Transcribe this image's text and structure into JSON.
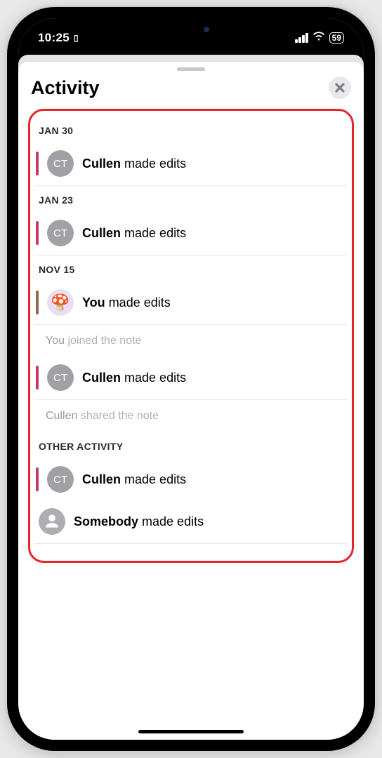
{
  "status": {
    "time": "10:25",
    "battery": "59"
  },
  "sheet": {
    "title": "Activity"
  },
  "sections": [
    {
      "key": "s0",
      "header": "JAN 30",
      "items": [
        {
          "kind": "edit",
          "bar": "pink",
          "avatar": "initials",
          "initials": "CT",
          "who": "Cullen",
          "action": "made edits"
        }
      ]
    },
    {
      "key": "s1",
      "header": "JAN 23",
      "items": [
        {
          "kind": "edit",
          "bar": "pink",
          "avatar": "initials",
          "initials": "CT",
          "who": "Cullen",
          "action": "made edits"
        }
      ]
    },
    {
      "key": "s2",
      "header": "NOV 15",
      "items": [
        {
          "kind": "edit",
          "bar": "brown",
          "avatar": "emoji",
          "emoji": "🍄",
          "who": "You",
          "action": "made edits"
        },
        {
          "kind": "meta",
          "who": "You",
          "action": "joined the note"
        },
        {
          "kind": "edit",
          "bar": "pink",
          "avatar": "initials",
          "initials": "CT",
          "who": "Cullen",
          "action": "made edits"
        },
        {
          "kind": "meta",
          "who": "Cullen",
          "action": "shared the note"
        }
      ]
    },
    {
      "key": "s3",
      "header": "OTHER ACTIVITY",
      "items": [
        {
          "kind": "edit",
          "bar": "pink",
          "avatar": "initials",
          "initials": "CT",
          "who": "Cullen",
          "action": "made edits",
          "nobord": true
        },
        {
          "kind": "edit",
          "bar": "none",
          "avatar": "silhouette",
          "who": "Somebody",
          "action": "made edits"
        }
      ]
    }
  ]
}
